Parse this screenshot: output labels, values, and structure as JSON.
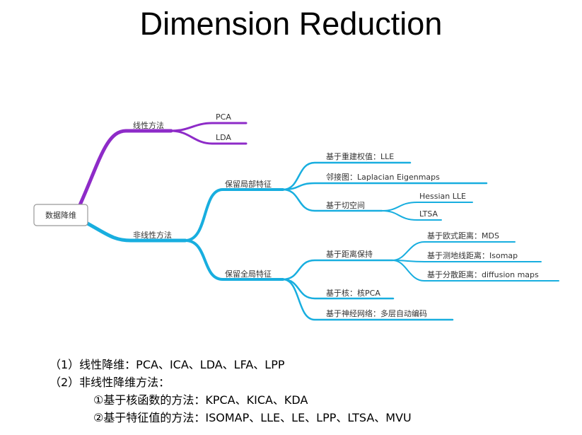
{
  "title": "Dimension Reduction",
  "colors": {
    "purple_branch": "#8E2BC8",
    "blue_branch": "#18AEDF",
    "root_border": "#999999",
    "text": "#333333"
  },
  "mindmap": {
    "root": "数据降维",
    "linear": {
      "label": "线性方法",
      "children": [
        "PCA",
        "LDA"
      ]
    },
    "nonlinear": {
      "label": "非线性方法",
      "local": {
        "label": "保留局部特征",
        "reweight": "基于重建权值：LLE",
        "adjacency": "邻接图：Laplacian Eigenmaps",
        "tangent": {
          "label": "基于切空间",
          "children": [
            "Hessian LLE",
            "LTSA"
          ]
        }
      },
      "global": {
        "label": "保留全局特征",
        "distance": {
          "label": "基于距离保持",
          "children": [
            "基于欧式距离：MDS",
            "基于测地线距离：Isomap",
            "基于分散距离：diffusion maps"
          ]
        },
        "kernel": "基于核：核PCA",
        "neural": "基于神经网络：多层自动编码"
      }
    }
  },
  "notes": {
    "line1": "（1）线性降维：PCA、ICA、LDA、LFA、LPP",
    "line2": "（2）非线性降维方法：",
    "line3": "①基于核函数的方法：KPCA、KICA、KDA",
    "line4": "②基于特征值的方法：ISOMAP、LLE、LE、LPP、LTSA、MVU"
  }
}
